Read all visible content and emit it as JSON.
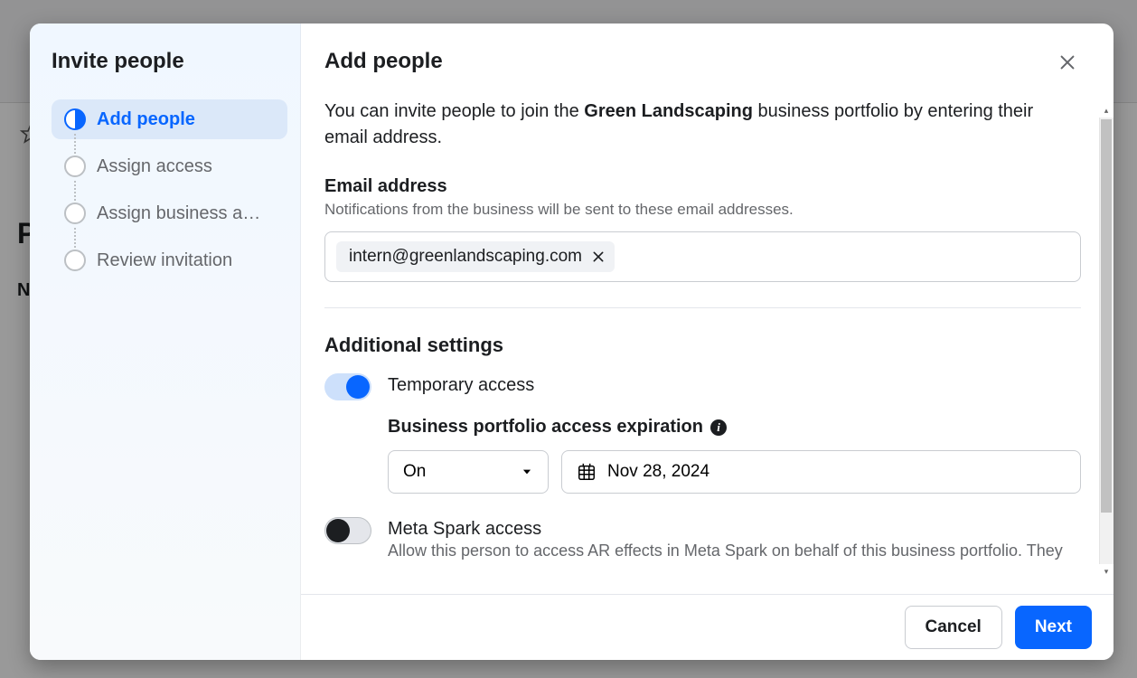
{
  "sidebar": {
    "title": "Invite people",
    "steps": [
      {
        "label": "Add people",
        "active": true
      },
      {
        "label": "Assign access",
        "active": false
      },
      {
        "label": "Assign business a…",
        "active": false
      },
      {
        "label": "Review invitation",
        "active": false
      }
    ]
  },
  "main": {
    "title": "Add people",
    "desc_prefix": "You can invite people to join the ",
    "desc_business": "Green Landscaping",
    "desc_suffix": " business portfolio by entering their email address.",
    "email_section": {
      "label": "Email address",
      "sub": "Notifications from the business will be sent to these email addresses.",
      "chips": [
        {
          "value": "intern@greenlandscaping.com"
        }
      ]
    },
    "settings": {
      "title": "Additional settings",
      "temporary": {
        "label": "Temporary access",
        "on": true
      },
      "expiration": {
        "title": "Business portfolio access expiration",
        "mode": "On",
        "date": "Nov 28, 2024"
      },
      "spark": {
        "label": "Meta Spark access",
        "desc": "Allow this person to access AR effects in Meta Spark on behalf of this business portfolio. They",
        "on": false
      }
    }
  },
  "footer": {
    "cancel": "Cancel",
    "next": "Next"
  },
  "bg": {
    "p": "P",
    "n": "N"
  }
}
